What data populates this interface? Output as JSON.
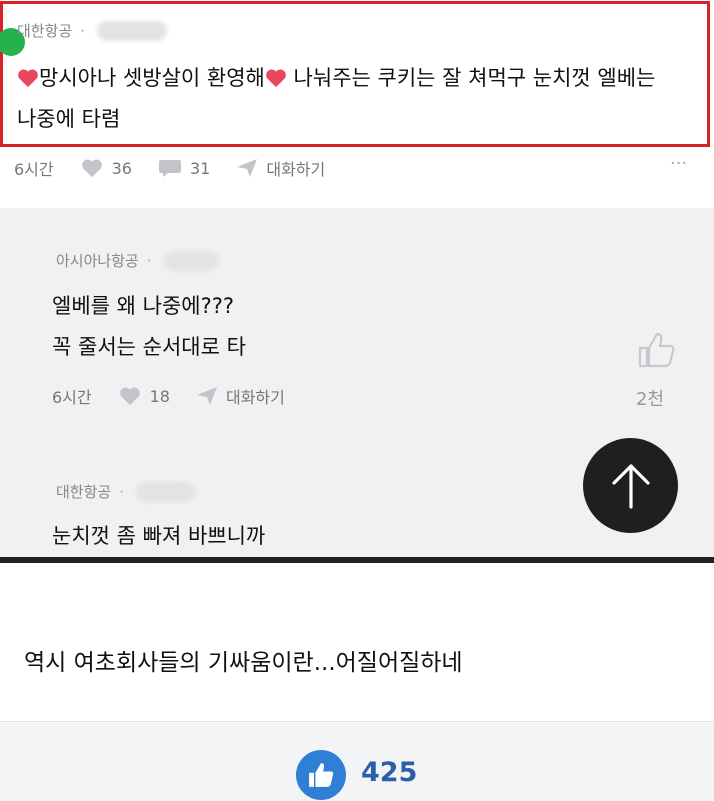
{
  "screenshot": {
    "comment1": {
      "airline": "대한항공",
      "text_line1_a": "망시아나 셋방살이 환영해",
      "text_line1_b": " 나눠주는 쿠키는 잘 쳐먹구 눈치껏 엘베는",
      "text_line2": "나중에 타렴",
      "time": "6시간",
      "likes": "36",
      "replies": "31",
      "reply_label": "대화하기",
      "more": "···"
    },
    "reply1": {
      "airline": "아시아나항공",
      "text_line1": "엘베를 왜 나중에???",
      "text_line2": "꼭 줄서는 순서대로 타",
      "time": "6시간",
      "likes": "18",
      "reply_label": "대화하기"
    },
    "side_count": "2천",
    "reply2": {
      "airline": "대한항공",
      "text_line1": "눈치껏 좀 빠져 바쁘니까"
    }
  },
  "caption": "역시 여초회사들의 기싸움이란...어질어질하네",
  "like_count": "425",
  "colors": {
    "highlight": "#d8232a",
    "heart": "#e8475e",
    "like_button": "#2f7fd6",
    "like_text": "#2b5fa8"
  }
}
